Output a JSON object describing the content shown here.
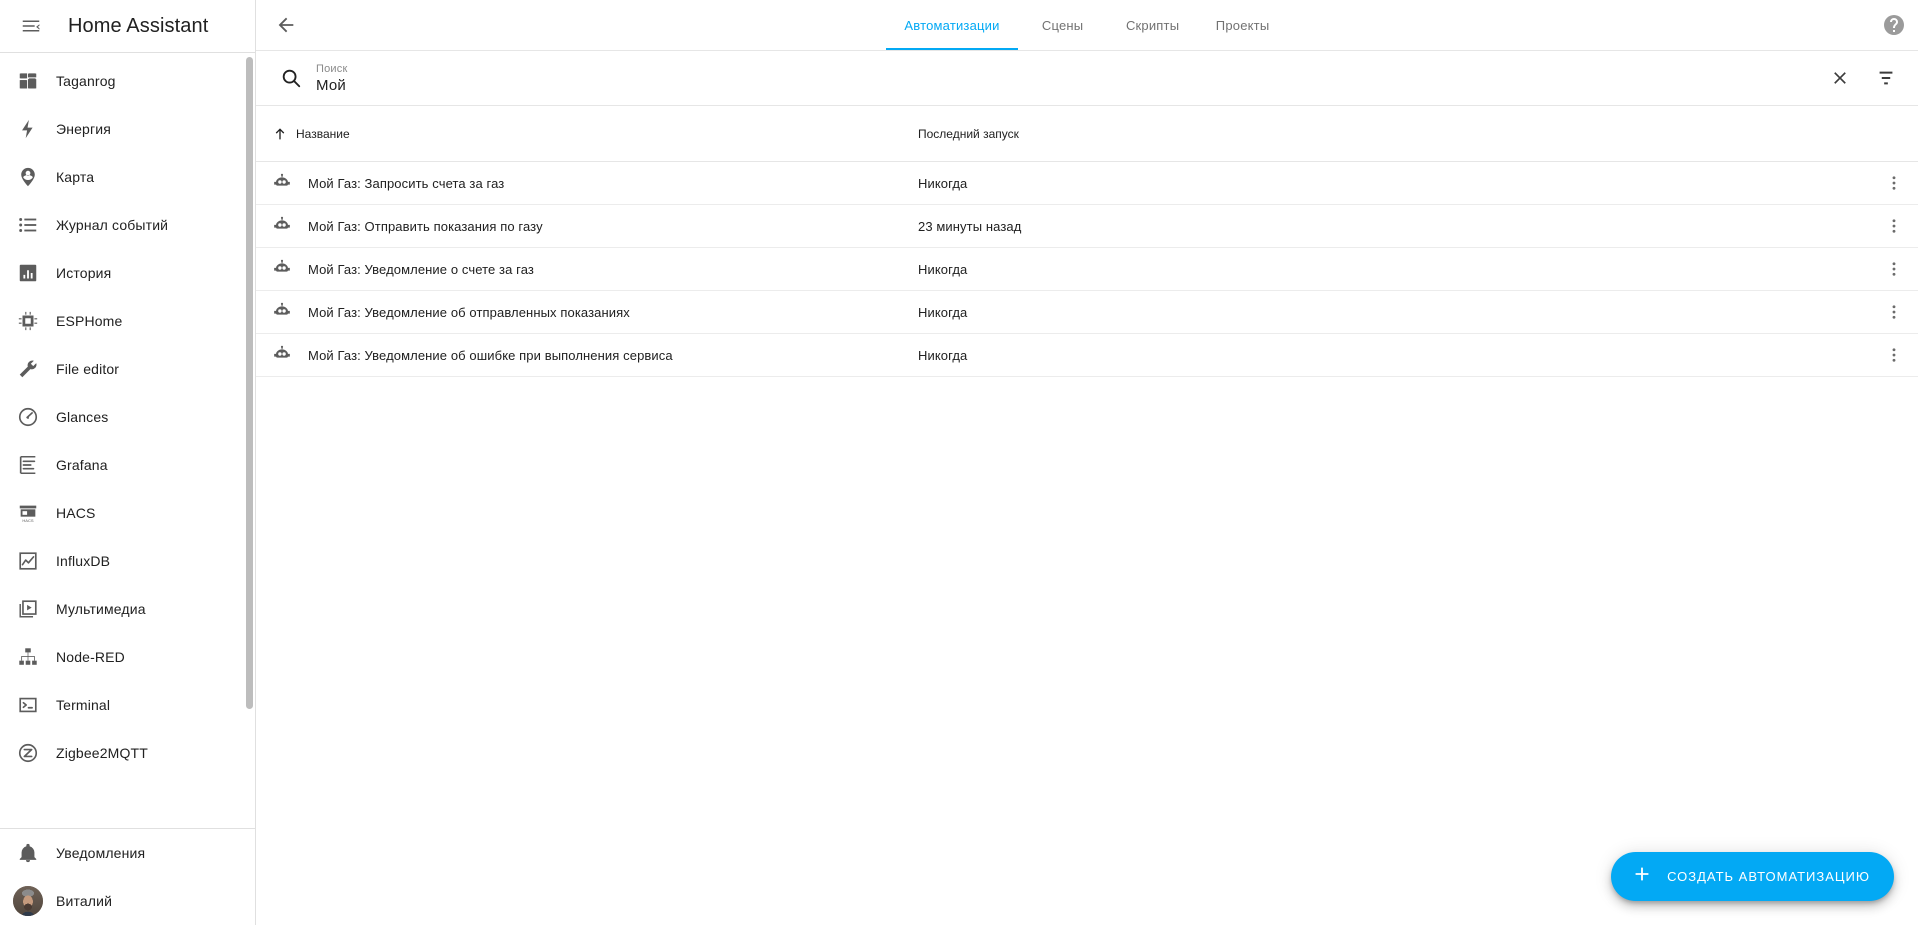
{
  "sidebar": {
    "title": "Home Assistant",
    "menu_icon": "menu-collapse-icon",
    "items": [
      {
        "label": "Taganrog",
        "icon": "view-dashboard-icon"
      },
      {
        "label": "Энергия",
        "icon": "lightning-bolt-icon"
      },
      {
        "label": "Карта",
        "icon": "map-marker-account-icon"
      },
      {
        "label": "Журнал событий",
        "icon": "format-list-bulleted-icon"
      },
      {
        "label": "История",
        "icon": "chart-box-icon"
      },
      {
        "label": "ESPHome",
        "icon": "chip-icon"
      },
      {
        "label": "File editor",
        "icon": "wrench-icon"
      },
      {
        "label": "Glances",
        "icon": "gauge-icon"
      },
      {
        "label": "Grafana",
        "icon": "chart-bar-box-icon"
      },
      {
        "label": "HACS",
        "icon": "storefront-icon"
      },
      {
        "label": "InfluxDB",
        "icon": "chart-line-box-icon"
      },
      {
        "label": "Мультимедиа",
        "icon": "play-box-icon"
      },
      {
        "label": "Node-RED",
        "icon": "sitemap-icon"
      },
      {
        "label": "Terminal",
        "icon": "console-icon"
      },
      {
        "label": "Zigbee2MQTT",
        "icon": "zigbee-icon"
      }
    ],
    "bottom_items": [
      {
        "label": "Уведомления",
        "icon": "bell-icon"
      },
      {
        "label": "Виталий",
        "icon": "user-avatar"
      }
    ]
  },
  "topbar": {
    "back_icon": "arrow-left-icon",
    "help_icon": "help-circle-icon",
    "tabs": [
      {
        "label": "Автоматизации",
        "active": true
      },
      {
        "label": "Сцены",
        "active": false
      },
      {
        "label": "Скрипты",
        "active": false
      },
      {
        "label": "Проекты",
        "active": false
      }
    ]
  },
  "search": {
    "icon": "search-icon",
    "label": "Поиск",
    "value": "Мой",
    "placeholder": "Поиск",
    "clear_icon": "close-icon",
    "filter_icon": "filter-variant-icon"
  },
  "table": {
    "columns": {
      "name": "Название",
      "last_triggered": "Последний запуск"
    },
    "sort": {
      "column": "name",
      "direction": "asc",
      "icon": "arrow-up-icon"
    },
    "row_icon": "robot-icon",
    "row_menu_icon": "dots-vertical-icon",
    "rows": [
      {
        "name": "Мой Газ: Запросить счета за газ",
        "last_triggered": "Никогда"
      },
      {
        "name": "Мой Газ: Отправить показания по газу",
        "last_triggered": "23 минуты назад"
      },
      {
        "name": "Мой Газ: Уведомление о счете за газ",
        "last_triggered": "Никогда"
      },
      {
        "name": "Мой Газ: Уведомление об отправленных показаниях",
        "last_triggered": "Никогда"
      },
      {
        "name": "Мой Газ: Уведомление об ошибке при выполнения сервиса",
        "last_triggered": "Никогда"
      }
    ]
  },
  "fab": {
    "label": "СОЗДАТЬ АВТОМАТИЗАЦИЮ",
    "icon": "plus-icon",
    "color": "#03A9F4"
  },
  "colors": {
    "accent": "#03A9F4",
    "text_primary": "#212121",
    "text_secondary": "#727272",
    "icon": "#5C5C5C",
    "divider": "#E0E0E0",
    "background": "#FFFFFF"
  }
}
